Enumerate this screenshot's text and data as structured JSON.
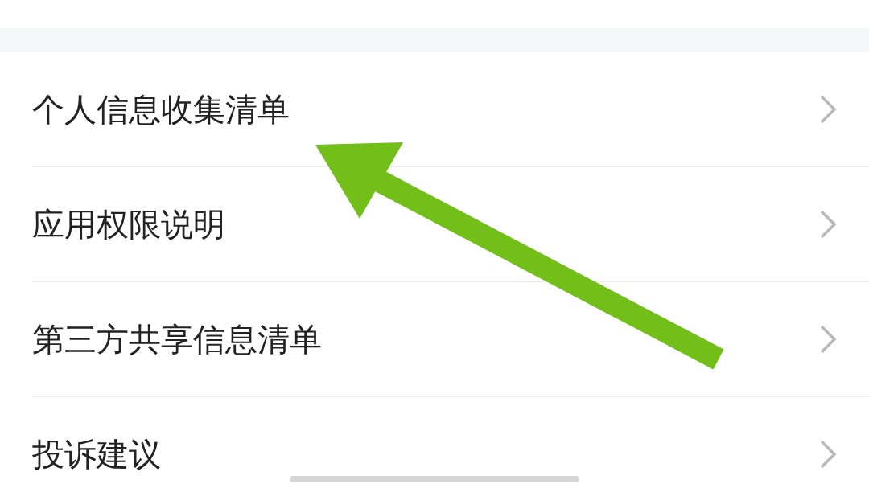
{
  "menu_items": [
    {
      "label": "个人信息收集清单"
    },
    {
      "label": "应用权限说明"
    },
    {
      "label": "第三方共享信息清单"
    },
    {
      "label": "投诉建议"
    }
  ]
}
